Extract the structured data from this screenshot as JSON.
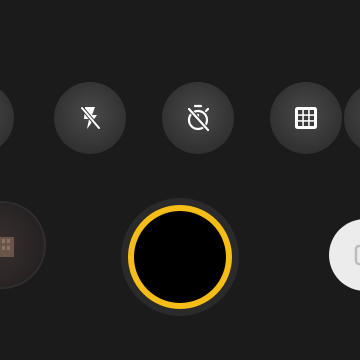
{
  "colors": {
    "background": "#1b1b1b",
    "shutter_ring": "#f6bd16",
    "button_bg": "#3a3a3a",
    "icon": "#ffffff"
  },
  "top_controls": [
    {
      "icon": "flash-off-icon",
      "state": "off"
    },
    {
      "icon": "timer-off-icon",
      "state": "off"
    },
    {
      "icon": "grid-icon",
      "state": "on"
    }
  ],
  "bottom_controls": {
    "gallery": {
      "icon": "gallery-thumbnail"
    },
    "shutter": {
      "icon": "shutter-button"
    },
    "switch_camera": {
      "icon": "switch-camera-icon"
    }
  }
}
